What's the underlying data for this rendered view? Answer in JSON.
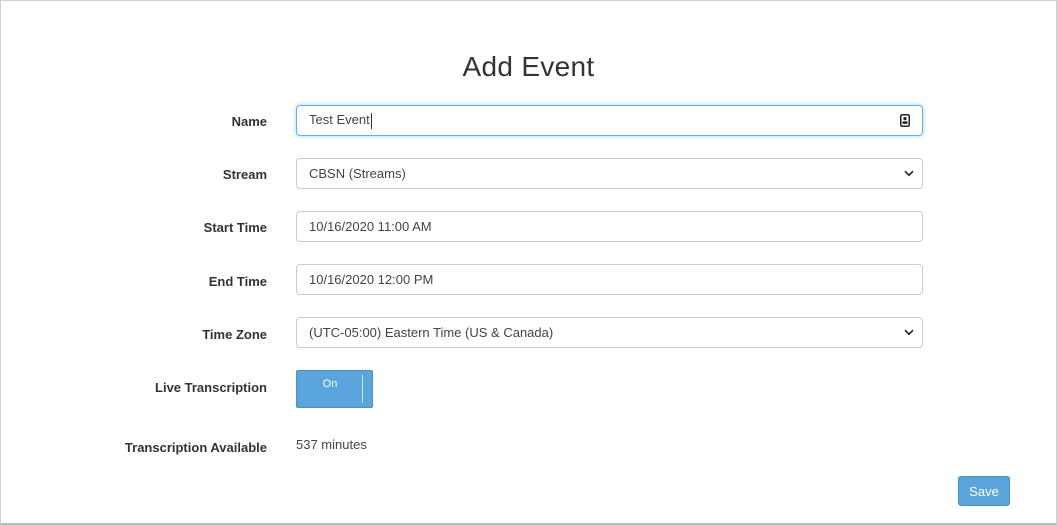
{
  "page": {
    "title": "Add Event"
  },
  "form": {
    "name": {
      "label": "Name",
      "value": "Test Event",
      "icon": "contact-card-icon"
    },
    "stream": {
      "label": "Stream",
      "selected": "CBSN (Streams)"
    },
    "start_time": {
      "label": "Start Time",
      "value": "10/16/2020 11:00 AM"
    },
    "end_time": {
      "label": "End Time",
      "value": "10/16/2020 12:00 PM"
    },
    "time_zone": {
      "label": "Time Zone",
      "selected": "(UTC-05:00) Eastern Time (US & Canada)"
    },
    "live_transcription": {
      "label": "Live Transcription",
      "state_label": "On",
      "on": true
    },
    "transcription_available": {
      "label": "Transcription Available",
      "value": "537 minutes"
    }
  },
  "actions": {
    "save_label": "Save"
  },
  "colors": {
    "accent": "#5aa6dc",
    "focus_border": "#66afe9"
  }
}
